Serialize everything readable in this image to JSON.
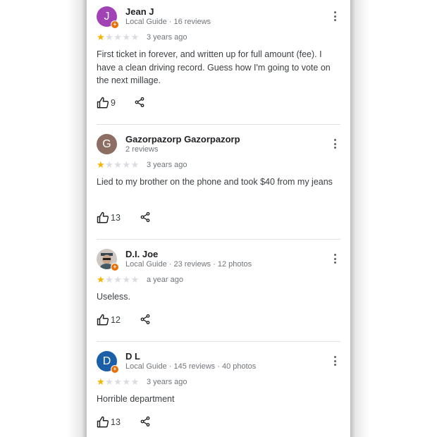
{
  "reviews": [
    {
      "avatar_letter": "J",
      "avatar_color": "#a142b5",
      "name": "Jean J",
      "meta": "Local Guide · 16 reviews",
      "rating": 1,
      "time": "3 years ago",
      "text": "First ticket in forever, and written up for full amount (fee). I have a clean driving record. Guess how I'm going to vote on the next millage.",
      "likes": "9"
    },
    {
      "avatar_letter": "G",
      "avatar_color": "#8d6e63",
      "name": "Gazorpazorp Gazorpazorp",
      "meta": "2 reviews",
      "rating": 1,
      "time": "3 years ago",
      "text": "Lied to my brother on the phone and took $40 from my jeans",
      "likes": "13"
    },
    {
      "avatar_letter": "",
      "avatar_color": "#d7ccc8",
      "name": "D.I. Joe",
      "meta": "Local Guide · 23 reviews · 12 photos",
      "rating": 1,
      "time": "a year ago",
      "text": "Useless.",
      "likes": "12"
    },
    {
      "avatar_letter": "D",
      "avatar_color": "#1a5fa8",
      "name": "D L",
      "meta": "Local Guide · 145 reviews · 40 photos",
      "rating": 1,
      "time": "3 years ago",
      "text": "Horrible department",
      "likes": "13"
    }
  ],
  "icons": {
    "more": "more-vert-icon",
    "like": "thumb-up-outline-icon",
    "share": "share-icon",
    "badge": "local-guide-badge-icon"
  }
}
